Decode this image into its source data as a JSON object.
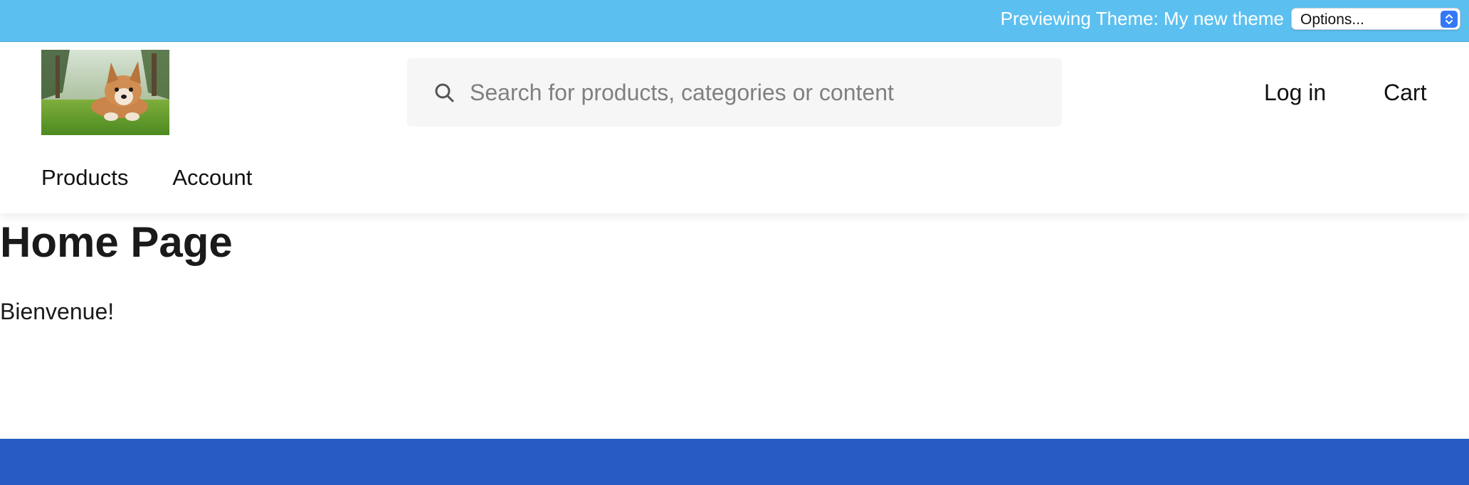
{
  "preview_bar": {
    "text": "Previewing Theme: My new theme",
    "options_label": "Options...",
    "background": "#5bc0f0"
  },
  "header": {
    "logo_alt": "Corgi puppy logo",
    "search": {
      "placeholder": "Search for products, categories or content",
      "value": ""
    },
    "login_label": "Log in",
    "cart_label": "Cart",
    "nav": [
      "Products",
      "Account"
    ]
  },
  "main": {
    "title": "Home Page",
    "body": "Bienvenue!"
  },
  "footer": {
    "color": "#285cc4"
  },
  "icons": {
    "search": "search-icon",
    "stepper": "chevron-up-down-icon"
  }
}
